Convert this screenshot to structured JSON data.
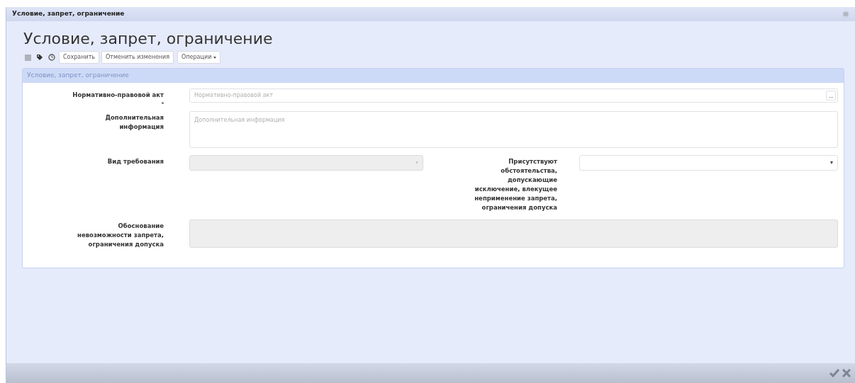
{
  "window": {
    "title": "Условие, запрет, ограничение"
  },
  "heading": "Условие, запрет, ограничение",
  "toolbar": {
    "buttons": [
      "Сохранить",
      "Отменить изменения"
    ],
    "menu": "Операции"
  },
  "panel": {
    "title": "Условие, запрет, ограничение",
    "rows": [
      [
        {
          "label": "Нормативно-правовой акт",
          "required": true,
          "kind": "lookup",
          "placeholder": "Нормативно-правовой акт",
          "disabled": false
        }
      ],
      [
        {
          "label": "Дополнительная информация",
          "required": false,
          "kind": "textarea",
          "placeholder": "Дополнительная информация",
          "disabled": false
        }
      ],
      [
        {
          "label": "Вид требования",
          "required": false,
          "kind": "select",
          "disabled": true
        },
        {
          "label": "Присутствуют обстоятельства, допускающие исключение, влекущее неприменение запрета, ограничения допуска",
          "required": false,
          "kind": "select",
          "disabled": false
        }
      ],
      [
        {
          "label": "Обоснование невозможности запрета, ограничения допуска",
          "required": false,
          "kind": "textarea",
          "disabled": true
        }
      ]
    ]
  }
}
